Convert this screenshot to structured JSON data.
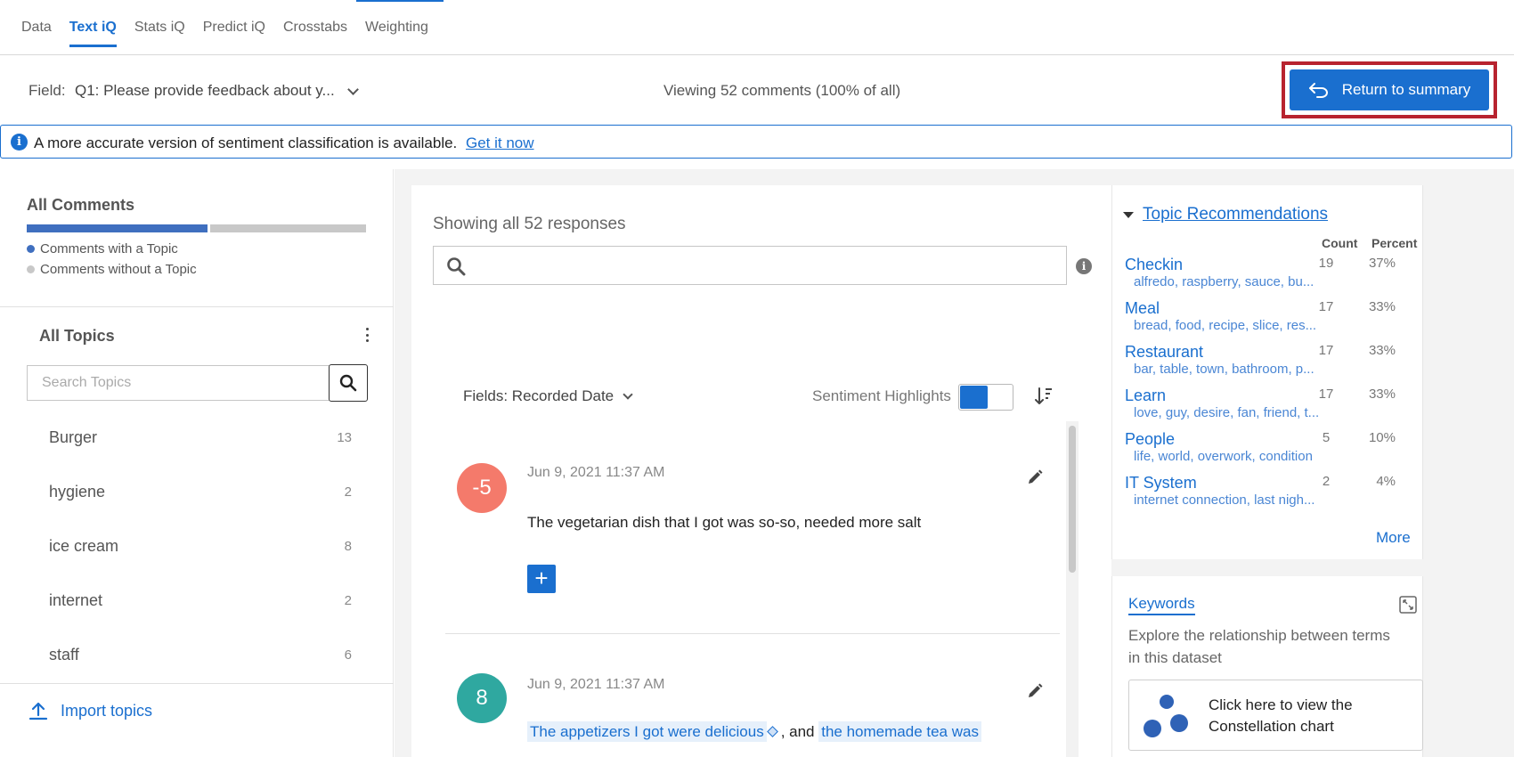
{
  "tabs": [
    "Data",
    "Text iQ",
    "Stats iQ",
    "Predict iQ",
    "Crosstabs",
    "Weighting"
  ],
  "active_tab": "Text iQ",
  "field": {
    "label": "Field:",
    "value": "Q1: Please provide feedback about y..."
  },
  "viewing": "Viewing 52 comments (100% of all)",
  "return_button": "Return to summary",
  "banner": {
    "message": "A more accurate version of sentiment classification is available.",
    "link": "Get it now"
  },
  "left": {
    "all_comments": "All Comments",
    "legend": [
      "Comments with a Topic",
      "Comments without a Topic"
    ],
    "with_topic_fraction": 0.54,
    "all_topics": "All Topics",
    "search_placeholder": "Search Topics",
    "topics": [
      {
        "name": "Burger",
        "count": "13"
      },
      {
        "name": "hygiene",
        "count": "2"
      },
      {
        "name": "ice cream",
        "count": "8"
      },
      {
        "name": "internet",
        "count": "2"
      },
      {
        "name": "staff",
        "count": "6"
      }
    ],
    "import": "Import topics"
  },
  "center": {
    "showing": "Showing all 52 responses",
    "fields_dropdown": "Fields: Recorded Date",
    "sentiment_label": "Sentiment Highlights",
    "comments": [
      {
        "score": "-5",
        "color": "#f47a6b",
        "date": "Jun 9, 2021 11:37 AM",
        "text": "The vegetarian dish that I got was so-so, needed more salt"
      },
      {
        "score": "8",
        "color": "#2fa8a0",
        "date": "Jun 9, 2021 11:37 AM",
        "highlight1": "The appetizers I got were delicious",
        "connector": ", and ",
        "highlight2": "the homemade tea was"
      }
    ]
  },
  "recommendations": {
    "title": "Topic Recommendations",
    "col_count": "Count",
    "col_percent": "Percent",
    "items": [
      {
        "name": "Checkin",
        "keywords": "alfredo, raspberry, sauce, bu...",
        "count": "19",
        "percent": "37%"
      },
      {
        "name": "Meal",
        "keywords": "bread, food, recipe, slice, res...",
        "count": "17",
        "percent": "33%"
      },
      {
        "name": "Restaurant",
        "keywords": "bar, table, town, bathroom, p...",
        "count": "17",
        "percent": "33%"
      },
      {
        "name": "Learn",
        "keywords": "love, guy, desire, fan, friend, t...",
        "count": "17",
        "percent": "33%"
      },
      {
        "name": "People",
        "keywords": "life, world, overwork, condition",
        "count": "5",
        "percent": "10%"
      },
      {
        "name": "IT System",
        "keywords": "internet connection, last nigh...",
        "count": "2",
        "percent": "4%"
      }
    ],
    "more": "More"
  },
  "keywords_panel": {
    "title": "Keywords",
    "description": "Explore the relationship between terms in this dataset",
    "card_text": "Click here to view the Constellation chart"
  },
  "colors": {
    "accent": "#1a6fcf",
    "highlight_border": "#b8232f",
    "bar_with": "#3f6fbf",
    "bar_without": "#c8c8c8"
  }
}
